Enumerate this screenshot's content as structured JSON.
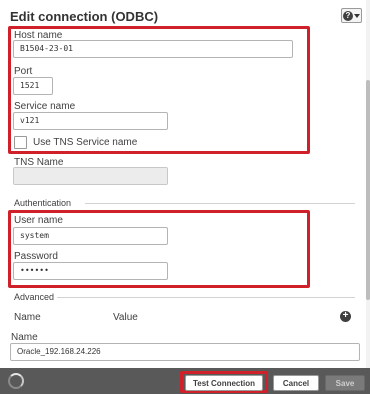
{
  "dialog": {
    "title": "Edit connection (ODBC)",
    "help_icon": "question-circle-icon"
  },
  "fields": {
    "host_name": {
      "label": "Host name",
      "value": "B1504-23-01"
    },
    "port": {
      "label": "Port",
      "value": "1521"
    },
    "service_name": {
      "label": "Service name",
      "value": "v121"
    },
    "use_tns": {
      "label": "Use TNS Service name",
      "checked": false
    },
    "tns_name": {
      "label": "TNS Name",
      "value": ""
    }
  },
  "authentication": {
    "heading": "Authentication",
    "user_name": {
      "label": "User name",
      "value": "system"
    },
    "password": {
      "label": "Password",
      "value": "••••••"
    }
  },
  "advanced": {
    "heading": "Advanced",
    "col_name": "Name",
    "col_value": "Value",
    "add_icon": "plus-circle-icon"
  },
  "connection_name": {
    "label": "Name",
    "value": "Oracle_192.168.24.226"
  },
  "footer": {
    "test_connection": "Test Connection",
    "cancel": "Cancel",
    "save": "Save"
  },
  "colors": {
    "highlight": "#d0212a",
    "footer_bg": "#595959"
  }
}
